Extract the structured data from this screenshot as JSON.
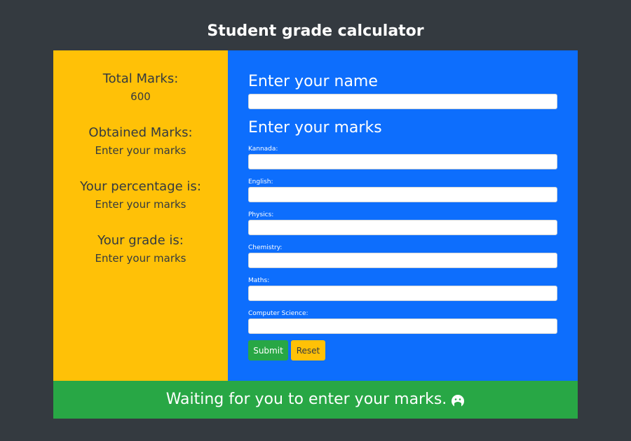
{
  "page": {
    "title": "Student grade calculator"
  },
  "summary": {
    "total_marks_label": "Total Marks:",
    "total_marks_value": "600",
    "obtained_marks_label": "Obtained Marks:",
    "obtained_marks_value": "Enter your marks",
    "percentage_label": "Your percentage is:",
    "percentage_value": "Enter your marks",
    "grade_label": "Your grade is:",
    "grade_value": "Enter your marks"
  },
  "form": {
    "name_heading": "Enter your name",
    "name_value": "",
    "marks_heading": "Enter your marks",
    "subjects": [
      {
        "label": "Kannada:",
        "value": ""
      },
      {
        "label": "English:",
        "value": ""
      },
      {
        "label": "Physics:",
        "value": ""
      },
      {
        "label": "Chemistry:",
        "value": ""
      },
      {
        "label": "Maths:",
        "value": ""
      },
      {
        "label": "Computer Science:",
        "value": ""
      }
    ],
    "submit_label": "Submit",
    "reset_label": "Reset"
  },
  "status": {
    "message": "Waiting for you to enter your marks.",
    "icon": "smiley-face-icon"
  },
  "colors": {
    "background": "#343a40",
    "summary_panel": "#ffc107",
    "form_panel": "#0d6efd",
    "status_bar": "#28a745",
    "submit_button": "#28a745",
    "reset_button": "#ffc107"
  }
}
